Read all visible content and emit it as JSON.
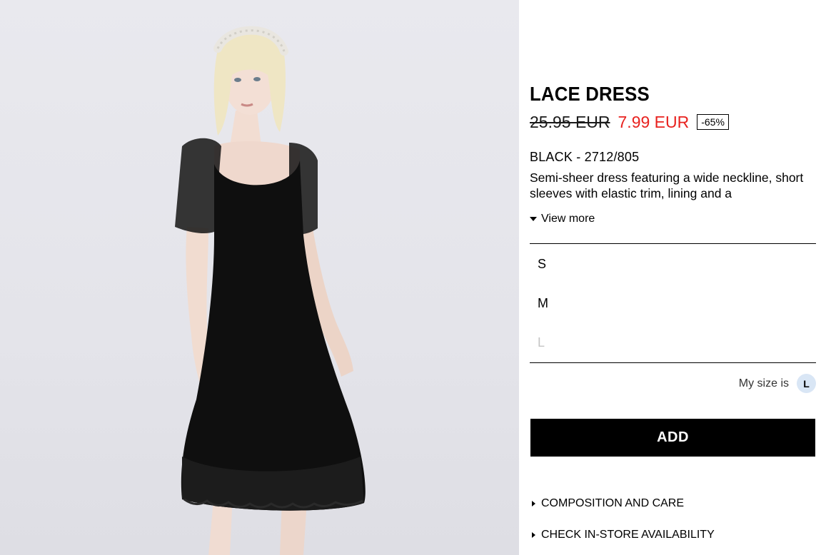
{
  "product": {
    "title": "LACE DRESS",
    "price_original": "25.95 EUR",
    "price_sale": "7.99 EUR",
    "discount": "-65%",
    "color_reference": "BLACK - 2712/805",
    "description": "Semi-sheer dress featuring a wide neckline, short sleeves with elastic trim, lining and a",
    "view_more_label": "View more"
  },
  "sizes": [
    {
      "label": "S",
      "available": true
    },
    {
      "label": "M",
      "available": true
    },
    {
      "label": "L",
      "available": false
    }
  ],
  "my_size": {
    "label": "My size is",
    "value": "L"
  },
  "add_button_label": "ADD",
  "accordion": [
    {
      "label": "COMPOSITION AND CARE"
    },
    {
      "label": "CHECK IN-STORE AVAILABILITY"
    }
  ],
  "colors": {
    "sale_price": "#e8221f",
    "photo_background": "#e6e6eb",
    "size_badge": "#d9e6f5",
    "unavailable_size": "#c4c4c4"
  }
}
